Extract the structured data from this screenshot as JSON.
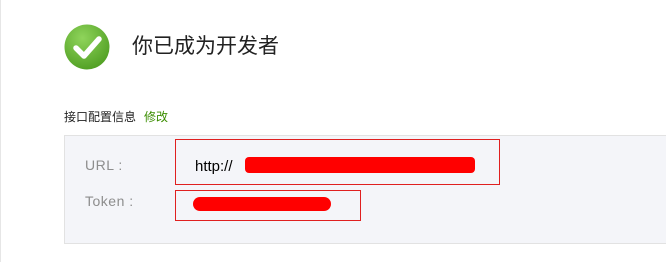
{
  "header": {
    "icon": "check-circle-icon",
    "title": "你已成为开发者"
  },
  "config": {
    "label": "接口配置信息",
    "edit_label": "修改"
  },
  "fields": {
    "url_label": "URL :",
    "url_value_prefix": "http://",
    "token_label": "Token :"
  },
  "colors": {
    "success_green": "#6cbf3a",
    "link_green": "#3b8d00",
    "redaction": "#ff0000",
    "panel_bg": "#f4f5f9"
  }
}
